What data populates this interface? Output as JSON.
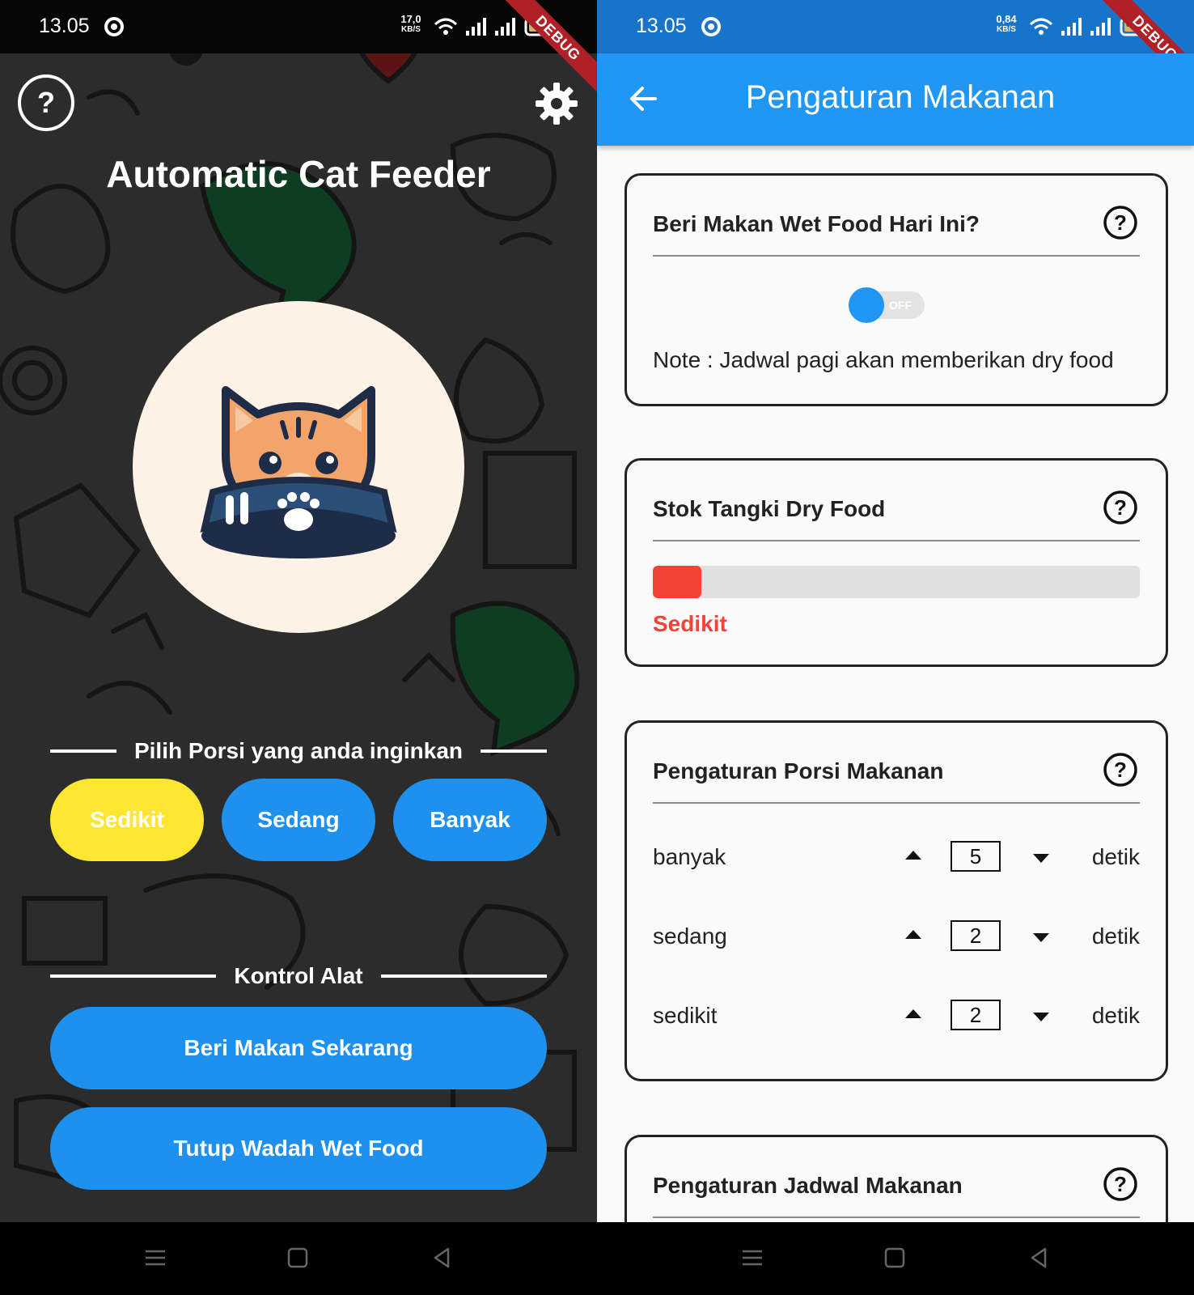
{
  "left_screen": {
    "status": {
      "time": "13.05",
      "speed_value": "17,0",
      "speed_unit": "KB/S",
      "battery": "80",
      "debug_banner": "DEBUG"
    },
    "title": "Automatic Cat Feeder",
    "help_icon_text": "?",
    "portion_section_label": "Pilih Porsi yang anda inginkan",
    "portions": [
      {
        "label": "Sedikit",
        "selected": true
      },
      {
        "label": "Sedang",
        "selected": false
      },
      {
        "label": "Banyak",
        "selected": false
      }
    ],
    "control_section_label": "Kontrol Alat",
    "actions": {
      "feed_now": "Beri Makan Sekarang",
      "close_wet_food": "Tutup Wadah Wet Food"
    },
    "colors": {
      "accent": "#1e90ee",
      "selected": "#fce632",
      "background": "#2b2b2b"
    }
  },
  "right_screen": {
    "status": {
      "time": "13.05",
      "speed_value": "0,84",
      "speed_unit": "KB/S",
      "battery": "80",
      "debug_banner": "DEBUG"
    },
    "appbar": {
      "title": "Pengaturan Makanan"
    },
    "wet_food_card": {
      "title": "Beri Makan Wet Food Hari Ini?",
      "toggle_state": "OFF",
      "note": "Note : Jadwal pagi akan memberikan dry food"
    },
    "stock_card": {
      "title": "Stok Tangki Dry Food",
      "level_fraction": 0.1,
      "level_label": "Sedikit"
    },
    "portion_card": {
      "title": "Pengaturan Porsi Makanan",
      "rows": [
        {
          "name": "banyak",
          "value": "5",
          "unit": "detik"
        },
        {
          "name": "sedang",
          "value": "2",
          "unit": "detik"
        },
        {
          "name": "sedikit",
          "value": "2",
          "unit": "detik"
        }
      ]
    },
    "schedule_card": {
      "title": "Pengaturan Jadwal Makanan"
    },
    "colors": {
      "appbar": "#2196f3",
      "statusbar": "#1874c9",
      "danger": "#f44336"
    }
  }
}
